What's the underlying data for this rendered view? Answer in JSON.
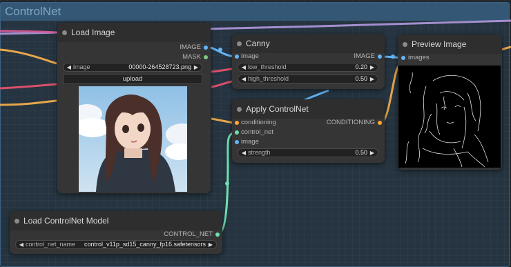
{
  "group": {
    "title": "ControlNet"
  },
  "nodes": {
    "load_image": {
      "title": "Load Image",
      "outputs": [
        "IMAGE",
        "MASK"
      ],
      "image_widget": {
        "label": "image",
        "value": "00000-264528723.png"
      },
      "upload_label": "upload"
    },
    "canny": {
      "title": "Canny",
      "input": "image",
      "output": "IMAGE",
      "low_threshold": {
        "label": "low_threshold",
        "value": "0.20"
      },
      "high_threshold": {
        "label": "high_threshold",
        "value": "0.50"
      }
    },
    "preview_image": {
      "title": "Preview Image",
      "input": "images"
    },
    "apply_controlnet": {
      "title": "Apply ControlNet",
      "inputs": [
        "conditioning",
        "control_net",
        "image"
      ],
      "output": "CONDITIONING",
      "strength": {
        "label": "strength",
        "value": "0.50"
      }
    },
    "load_controlnet_model": {
      "title": "Load ControlNet Model",
      "output": "CONTROL_NET",
      "model_widget": {
        "label": "control_net_name",
        "value": "control_v11p_sd15_canny_fp16.safetensors"
      }
    }
  },
  "colors": {
    "image_port": "#64b5f6",
    "mask_port": "#81c784",
    "conditioning_port": "#ffa931",
    "control_net_port": "#70e0b0",
    "wire_clip": "#b39ddb",
    "wire_latent": "#ff9cf9",
    "wire_model": "#ffb74d",
    "wire_image": "#64b5f6",
    "wire_controlnet": "#7be0b8",
    "wire_red": "#e0536b"
  },
  "icons": [
    "title-dot-icon",
    "arrow-left-icon",
    "arrow-right-icon"
  ]
}
